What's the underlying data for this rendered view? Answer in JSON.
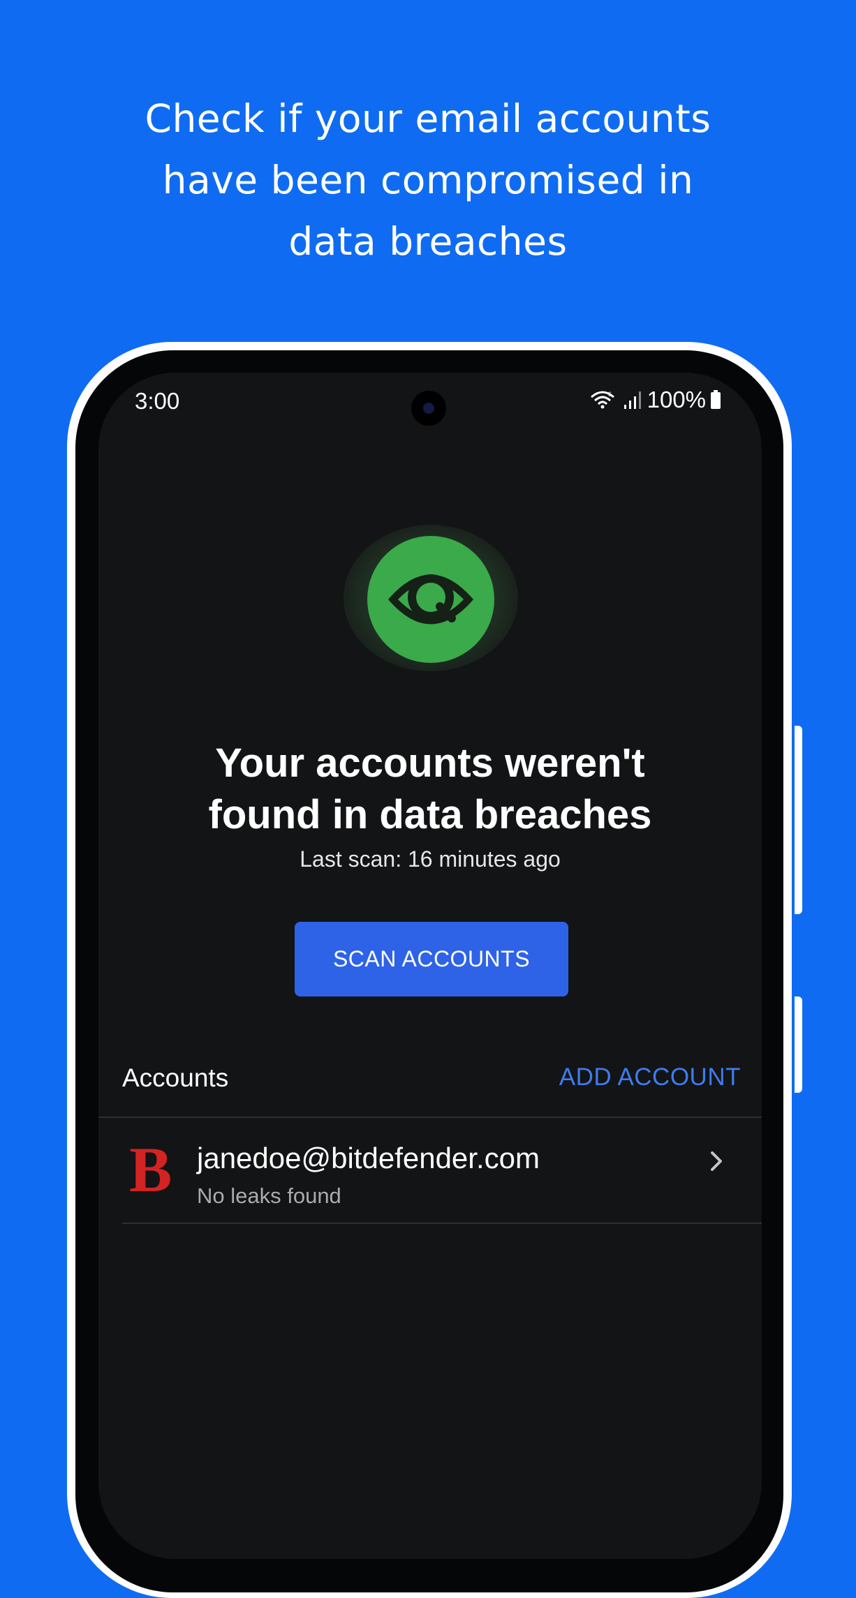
{
  "promo": {
    "headline_lines": [
      "Check if your email accounts",
      "have been compromised in",
      "data breaches"
    ]
  },
  "status_bar": {
    "time": "3:00",
    "battery": "100%",
    "icons": [
      "wifi-icon",
      "signal-icon",
      "battery-icon"
    ]
  },
  "scan_result": {
    "icon": "eye-search-icon",
    "title_lines": [
      "Your accounts weren't",
      "found in data breaches"
    ],
    "last_scan": "Last scan: 16 minutes ago",
    "scan_button_label": "SCAN ACCOUNTS"
  },
  "accounts": {
    "header": "Accounts",
    "add_label": "ADD ACCOUNT",
    "items": [
      {
        "logo": "B",
        "email": "janedoe@bitdefender.com",
        "status": "No leaks found"
      }
    ]
  },
  "colors": {
    "background": "#0F6CF2",
    "screen": "#121415",
    "accent_green": "#3AAA4B",
    "button_blue": "#2E63E8",
    "link_blue": "#3F7BEF",
    "logo_red": "#D42323"
  }
}
